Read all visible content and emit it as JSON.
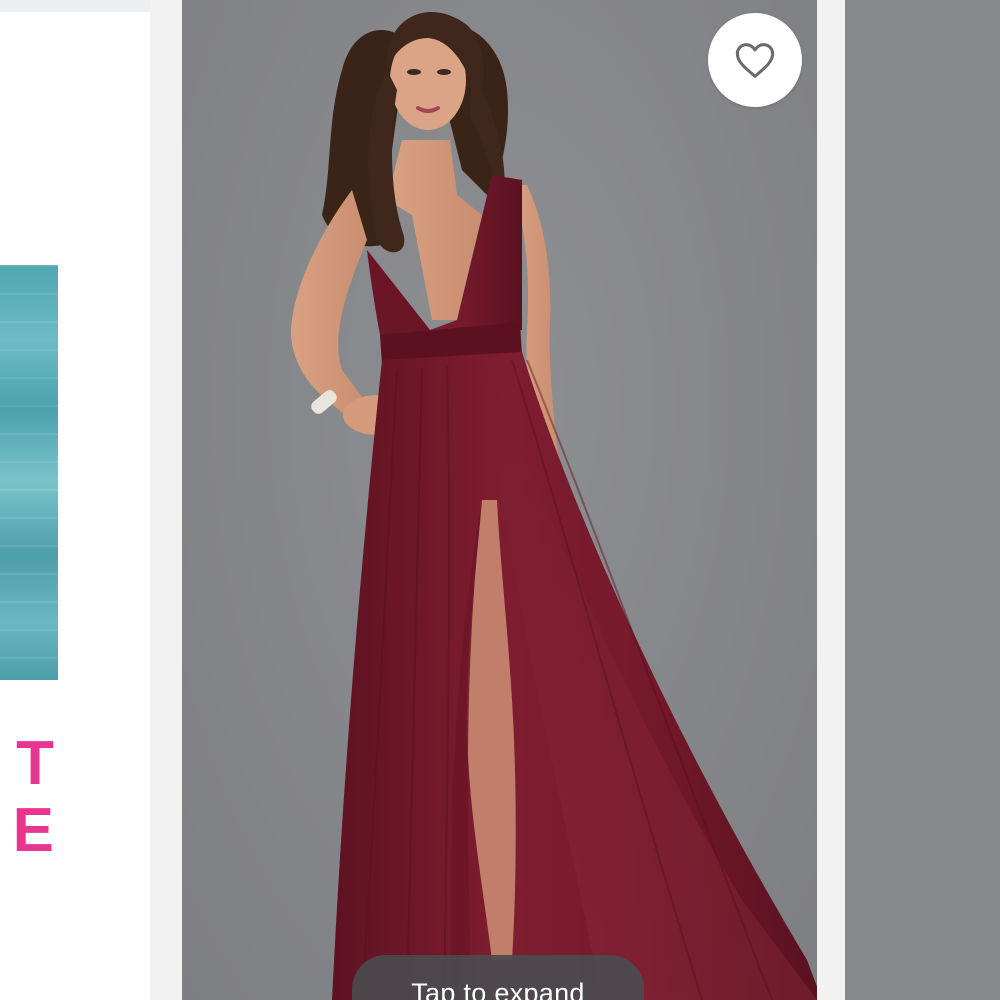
{
  "left_card": {
    "promo_line_1": "T",
    "promo_line_2": "E"
  },
  "main_card": {
    "image_alt": "Model wearing long burgundy plunging V-neck tulle gown with slit",
    "favorite_icon": "heart-outline-icon",
    "expand_hint": "Tap to expand"
  },
  "colors": {
    "promo_pink": "#e8358f",
    "dress_burgundy": "#7a1b2c",
    "photo_backdrop": "#858689"
  }
}
